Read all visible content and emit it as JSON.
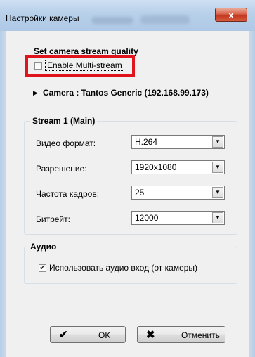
{
  "window": {
    "title": "Настройки камеры",
    "close_glyph": "x"
  },
  "quality": {
    "heading": "Set camera stream quality",
    "multistream_label": "Enable Multi-stream",
    "multistream_checked": false
  },
  "camera": {
    "arrow_glyph": "▶",
    "label": "Camera : Tantos Generic (192.168.99.173)"
  },
  "stream1": {
    "legend": "Stream 1 (Main)",
    "fields": [
      {
        "label": "Видео формат:",
        "value": "H.264"
      },
      {
        "label": "Разрешение:",
        "value": "1920x1080"
      },
      {
        "label": "Частота кадров:",
        "value": "25"
      },
      {
        "label": "Битрейт:",
        "value": "12000"
      }
    ],
    "dropdown_glyph": "▼"
  },
  "audio": {
    "legend": "Аудио",
    "use_audio_label": "Использовать аудио вход (от камеры)",
    "use_audio_checked": true,
    "check_glyph": "✔"
  },
  "buttons": {
    "ok_label": "OK",
    "ok_icon": "✔",
    "cancel_label": "Отменить",
    "cancel_icon": "✖"
  }
}
